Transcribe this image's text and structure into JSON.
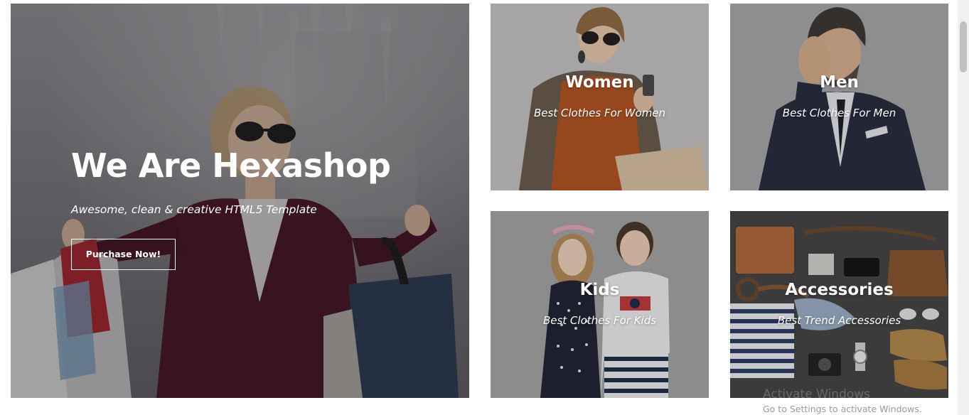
{
  "hero": {
    "title": "We Are Hexashop",
    "subtitle": "Awesome, clean & creative HTML5 Template",
    "button_label": "Purchase Now!"
  },
  "categories": [
    {
      "title": "Women",
      "subtitle": "Best Clothes For Women"
    },
    {
      "title": "Men",
      "subtitle": "Best Clothes For Men"
    },
    {
      "title": "Kids",
      "subtitle": "Best Clothes For Kids"
    },
    {
      "title": "Accessories",
      "subtitle": "Best Trend Accessories"
    }
  ],
  "watermark": {
    "title": "Activate Windows",
    "subtitle": "Go to Settings to activate Windows."
  },
  "colors": {
    "text": "#ffffff",
    "button_border": "#ffffff"
  }
}
